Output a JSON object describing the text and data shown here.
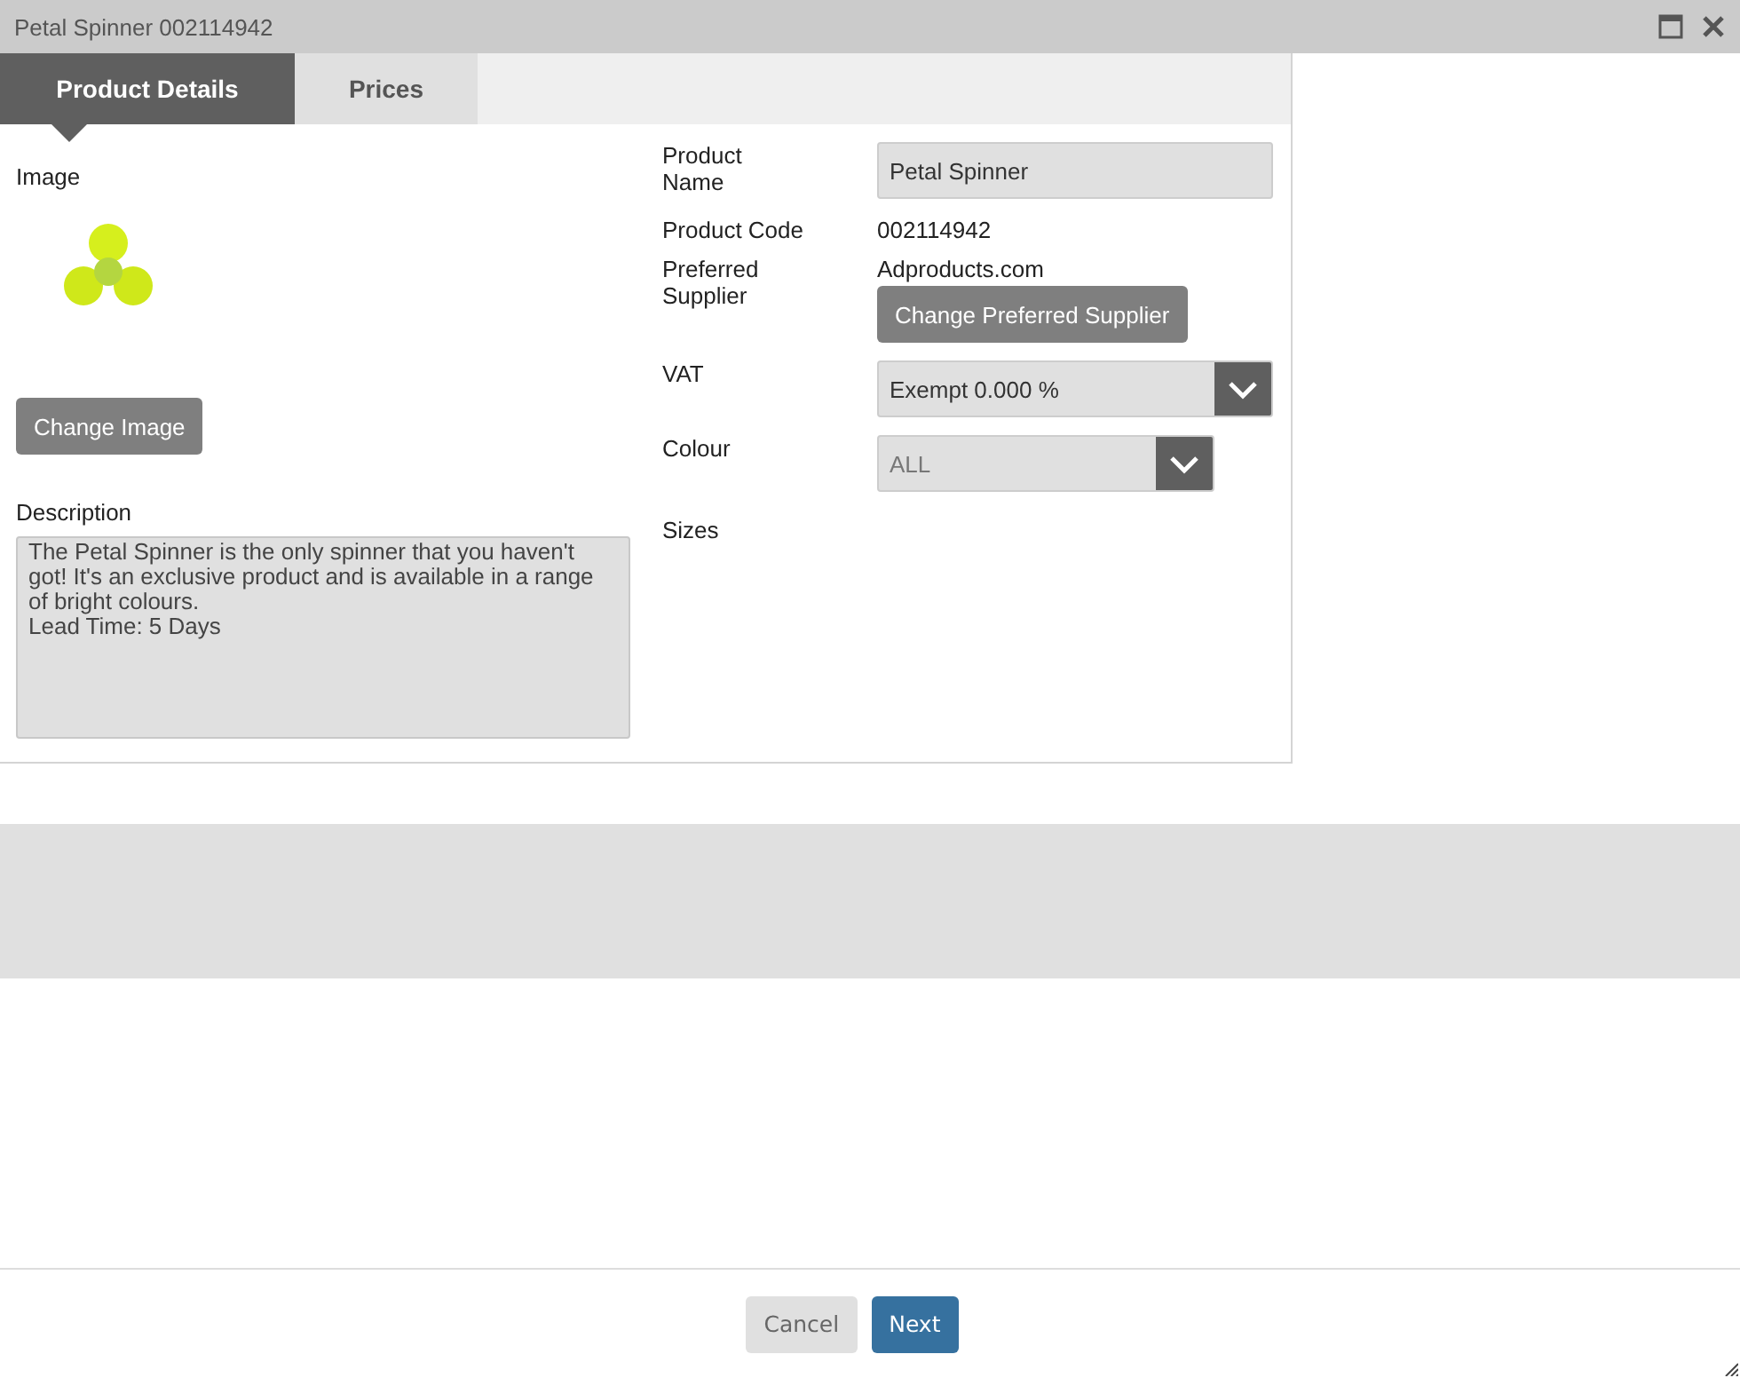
{
  "window": {
    "title": "Petal Spinner 002114942"
  },
  "tabs": [
    {
      "label": "Product Details",
      "selected": true
    },
    {
      "label": "Prices",
      "selected": false
    }
  ],
  "image": {
    "label": "Image",
    "button": "Change Image"
  },
  "description": {
    "label": "Description",
    "value": "The Petal Spinner is the only spinner that you haven't got! It's an exclusive product and is available in a range of bright colours.\nLead Time: 5 Days"
  },
  "fields": [
    {
      "kind": "input",
      "label": "Product Name",
      "value": "Petal Spinner"
    },
    {
      "kind": "text",
      "label": "Product Code",
      "value": "002114942"
    },
    {
      "kind": "supplier",
      "label": "Preferred Supplier",
      "value": "Adproducts.com",
      "button": "Change Preferred Supplier"
    },
    {
      "kind": "select",
      "label": "VAT",
      "value": "Exempt 0.000 %"
    },
    {
      "kind": "short-select",
      "label": "Colour",
      "value": "ALL"
    },
    {
      "kind": "empty",
      "label": "Sizes"
    }
  ],
  "buttons": [
    {
      "kind": "secondary",
      "label": "Cancel"
    },
    {
      "kind": "primary",
      "label": "Next"
    }
  ]
}
